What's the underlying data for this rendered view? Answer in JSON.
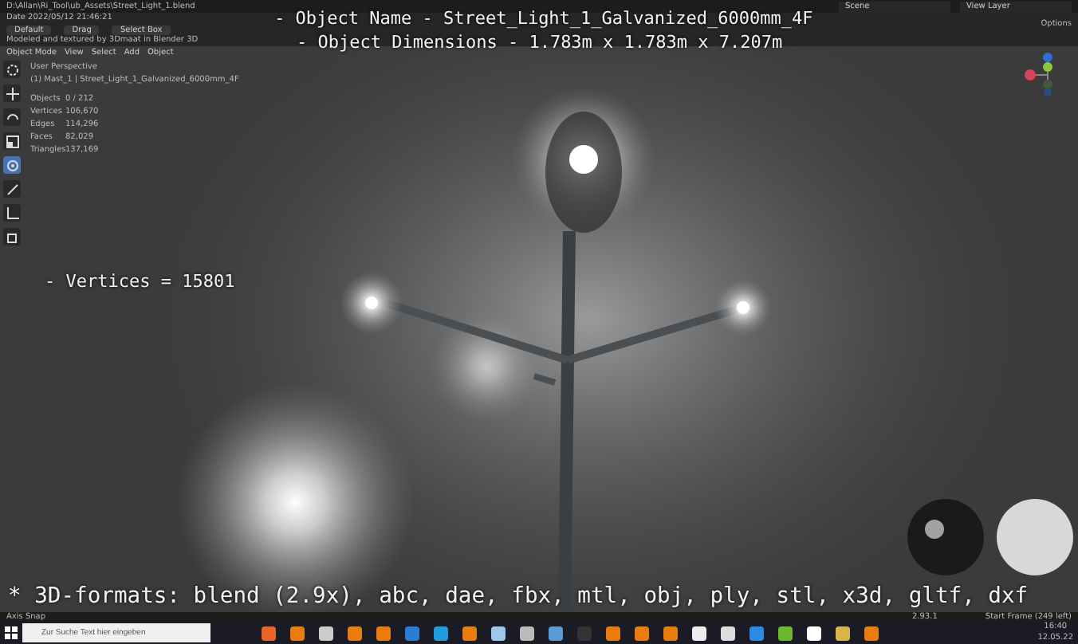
{
  "file_info": {
    "path": "D:\\Allan\\Ri_Tool\\ub_Assets\\Street_Light_1.blend",
    "date": "Date 2022/05/12 21:46:21",
    "credit": "Modeled and textured by 3Dmaat in Blender 3D"
  },
  "header_right": [
    {
      "label": "Scene"
    },
    {
      "label": "View Layer"
    }
  ],
  "tool_settings": [
    {
      "label": "Default"
    },
    {
      "label": "Drag"
    },
    {
      "label": "Select Box"
    }
  ],
  "menu": [
    "Object Mode",
    "View",
    "Select",
    "Add",
    "Object"
  ],
  "options_label": "Options",
  "tools": [
    {
      "kind": "cursor",
      "selected": false
    },
    {
      "kind": "move",
      "selected": false
    },
    {
      "kind": "rotate",
      "selected": false
    },
    {
      "kind": "scale",
      "selected": false
    },
    {
      "kind": "transform",
      "selected": true
    },
    {
      "kind": "annotate",
      "selected": false
    },
    {
      "kind": "measure",
      "selected": false
    },
    {
      "kind": "add-cube",
      "selected": false
    }
  ],
  "viewport_info": {
    "view": "User Perspective",
    "object": "(1) Mast_1 | Street_Light_1_Galvanized_6000mm_4F",
    "stats": [
      {
        "label": "Objects",
        "value": "0 / 212"
      },
      {
        "label": "Vertices",
        "value": "106,670"
      },
      {
        "label": "Edges",
        "value": "114,296"
      },
      {
        "label": "Faces",
        "value": "82,029"
      },
      {
        "label": "Triangles",
        "value": "137,169"
      }
    ]
  },
  "overlay": {
    "object_name": "- Object Name - Street_Light_1_Galvanized_6000mm_4F",
    "dimensions": "- Object Dimensions -  1.783m x 1.783m x 7.207m",
    "vertices": "- Vertices = 15801",
    "formats": "* 3D-formats: blend (2.9x), abc, dae, fbx, mtl, obj, ply, stl, x3d, gltf, dxf"
  },
  "status_bar": {
    "left": "Axis Snap",
    "version": "2.93.1",
    "right": "Start Frame (249 left)"
  },
  "taskbar": {
    "search_placeholder": "Zur Suche Text hier eingeben",
    "time": "16:40",
    "date": "12.05.22",
    "apps": [
      {
        "color": "#e8632a"
      },
      {
        "color": "#e87d0d"
      },
      {
        "color": "#cccccc"
      },
      {
        "color": "#e87d0d"
      },
      {
        "color": "#e87d0d"
      },
      {
        "color": "#2b7cd3"
      },
      {
        "color": "#1f9bde"
      },
      {
        "color": "#e87d0d"
      },
      {
        "color": "#9fc8e8"
      },
      {
        "color": "#bbbbbb"
      },
      {
        "color": "#5a9bd5"
      },
      {
        "color": "#333333"
      },
      {
        "color": "#e87d0d"
      },
      {
        "color": "#e87d0d"
      },
      {
        "color": "#e87d0d"
      },
      {
        "color": "#eeeeee"
      },
      {
        "color": "#dddddd"
      },
      {
        "color": "#2b8ae2"
      },
      {
        "color": "#6ab82e"
      },
      {
        "color": "#ffffff"
      },
      {
        "color": "#d9b44a"
      },
      {
        "color": "#e87d0d"
      }
    ]
  }
}
